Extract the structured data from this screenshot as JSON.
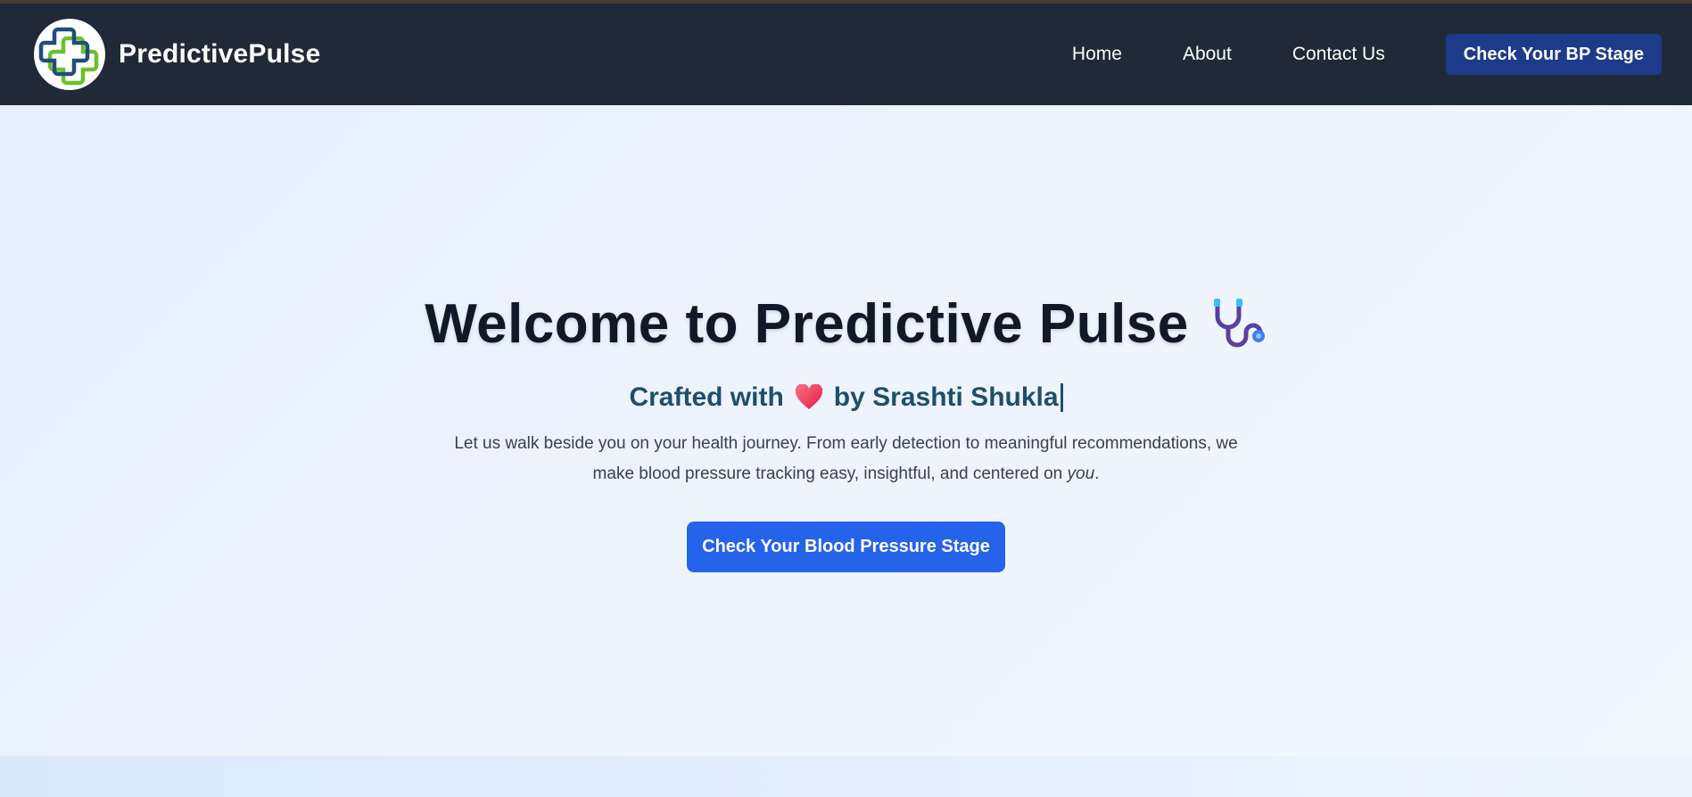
{
  "navbar": {
    "brand_name": "PredictivePulse",
    "logo_icon": "medical-cross-icon",
    "links": [
      "Home",
      "About",
      "Contact Us"
    ],
    "cta_label": "Check Your BP Stage"
  },
  "hero": {
    "title": "Welcome to Predictive Pulse",
    "title_icon": "stethoscope-icon",
    "subtitle_before": "Crafted with",
    "subtitle_icon": "heart-icon",
    "subtitle_after": "by Srashti Shukla",
    "description_line1": "Let us walk beside you on your health journey. From early detection to meaningful recommendations, we",
    "description_line2": "make blood pressure tracking easy, insightful, and centered on",
    "description_emphasis": "you",
    "description_end": ".",
    "cta_label": "Check Your Blood Pressure Stage"
  },
  "colors": {
    "navbar_bg": "#1f2937",
    "nav_cta_bg": "#1e3a8a",
    "hero_cta_bg": "#2563eb",
    "subtitle": "#1e4f6b",
    "title": "#111827"
  }
}
